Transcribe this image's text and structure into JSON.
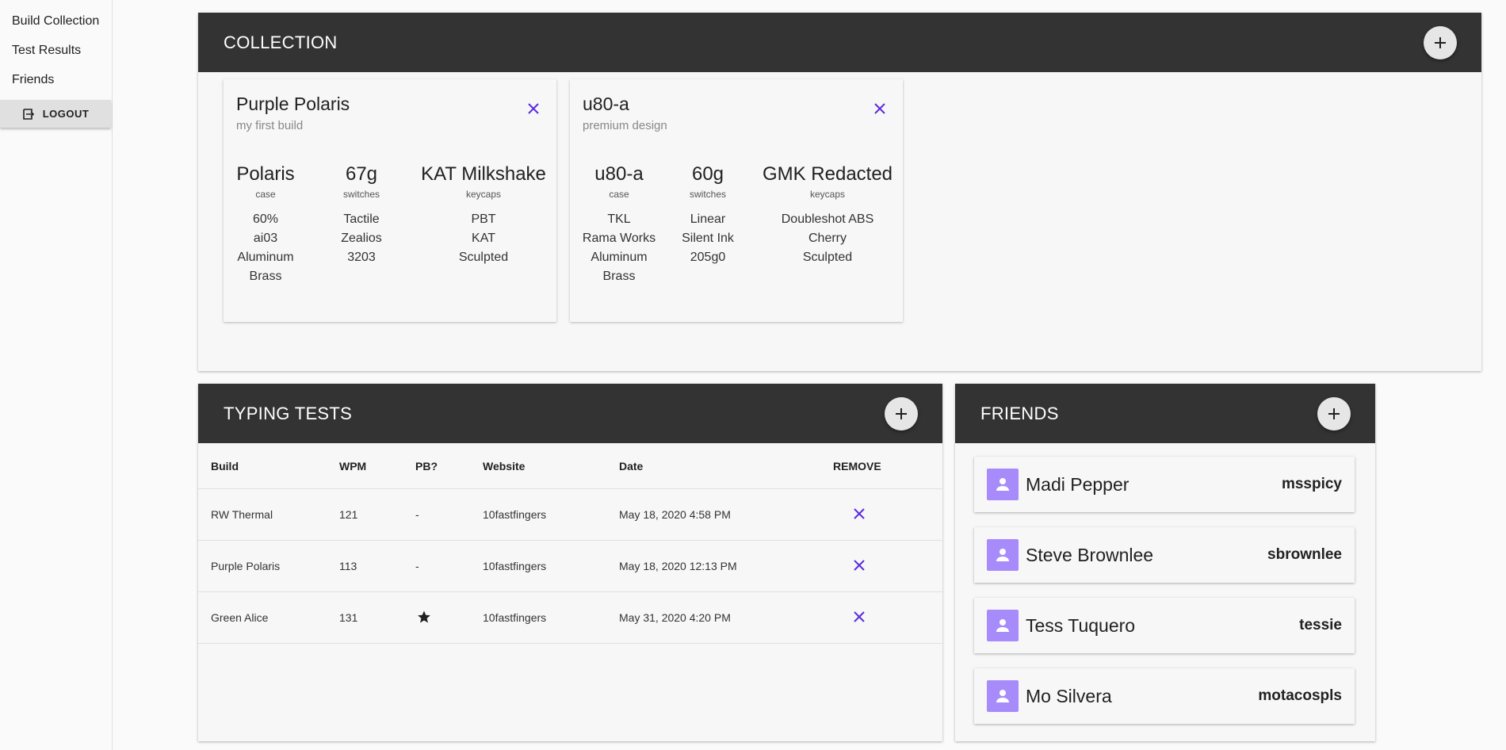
{
  "sidebar": {
    "items": [
      {
        "label": "Build Collection"
      },
      {
        "label": "Test Results"
      },
      {
        "label": "Friends"
      }
    ],
    "logout_label": "LOGOUT"
  },
  "collection": {
    "title": "COLLECTION",
    "builds": [
      {
        "name": "Purple Polaris",
        "description": "my first build",
        "case": {
          "main": "Polaris",
          "label": "case",
          "details": [
            "60%",
            "ai03",
            "Aluminum",
            "Brass"
          ]
        },
        "switches": {
          "main": "67g",
          "label": "switches",
          "details": [
            "Tactile",
            "Zealios",
            "3203"
          ]
        },
        "keycaps": {
          "main": "KAT Milkshake",
          "label": "keycaps",
          "details": [
            "PBT",
            "KAT",
            "Sculpted"
          ]
        }
      },
      {
        "name": "u80-a",
        "description": "premium design",
        "case": {
          "main": "u80-a",
          "label": "case",
          "details": [
            "TKL",
            "Rama Works",
            "Aluminum",
            "Brass"
          ]
        },
        "switches": {
          "main": "60g",
          "label": "switches",
          "details": [
            "Linear",
            "Silent Ink",
            "205g0"
          ]
        },
        "keycaps": {
          "main": "GMK Redacted",
          "label": "keycaps",
          "details": [
            "Doubleshot ABS",
            "Cherry",
            "Sculpted"
          ]
        }
      }
    ]
  },
  "typing_tests": {
    "title": "TYPING TESTS",
    "columns": [
      "Build",
      "WPM",
      "PB?",
      "Website",
      "Date",
      "REMOVE"
    ],
    "rows": [
      {
        "build": "RW Thermal",
        "wpm": "121",
        "pb": "-",
        "website": "10fastfingers",
        "date": "May 18, 2020 4:58 PM"
      },
      {
        "build": "Purple Polaris",
        "wpm": "113",
        "pb": "-",
        "website": "10fastfingers",
        "date": "May 18, 2020 12:13 PM"
      },
      {
        "build": "Green Alice",
        "wpm": "131",
        "pb": "",
        "website": "10fastfingers",
        "date": "May 31, 2020 4:20 PM"
      }
    ]
  },
  "friends": {
    "title": "FRIENDS",
    "list": [
      {
        "name": "Madi Pepper",
        "handle": "msspicy"
      },
      {
        "name": "Steve Brownlee",
        "handle": "sbrownlee"
      },
      {
        "name": "Tess Tuquero",
        "handle": "tessie"
      },
      {
        "name": "Mo Silvera",
        "handle": "motacospls"
      }
    ]
  },
  "colors": {
    "header_bg": "#333333",
    "accent": "#5b2be0",
    "avatar": "#a78bfa"
  },
  "icons": {
    "add": "plus-icon",
    "remove": "close-icon",
    "pb": "star-icon",
    "avatar": "person-icon",
    "logout": "logout-icon"
  }
}
